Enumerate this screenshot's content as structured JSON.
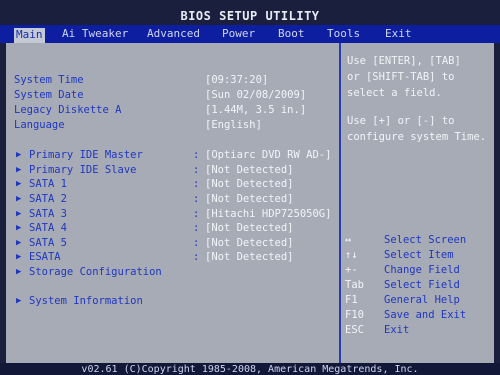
{
  "title": "BIOS SETUP UTILITY",
  "menu": [
    {
      "label": "Main",
      "active": true
    },
    {
      "label": "Ai Tweaker"
    },
    {
      "label": "Advanced"
    },
    {
      "label": "Power"
    },
    {
      "label": "Boot"
    },
    {
      "label": "Tools"
    },
    {
      "label": "Exit"
    }
  ],
  "settings": [
    {
      "label": "System Time",
      "value": "[09:37:20]"
    },
    {
      "label": "System Date",
      "value": "[Sun 02/08/2009]"
    },
    {
      "label": "Legacy Diskette A",
      "value": "[1.44M, 3.5 in.]"
    },
    {
      "label": "Language",
      "value": "[English]"
    }
  ],
  "devices": [
    {
      "label": "Primary IDE Master",
      "value": "[Optiarc DVD RW AD-]"
    },
    {
      "label": "Primary IDE Slave",
      "value": "[Not Detected]"
    },
    {
      "label": "SATA 1",
      "value": "[Not Detected]"
    },
    {
      "label": "SATA 2",
      "value": "[Not Detected]"
    },
    {
      "label": "SATA 3",
      "value": "[Hitachi HDP725050G]"
    },
    {
      "label": "SATA 4",
      "value": "[Not Detected]"
    },
    {
      "label": "SATA 5",
      "value": "[Not Detected]"
    },
    {
      "label": "ESATA",
      "value": "[Not Detected]"
    }
  ],
  "storage_config": "Storage Configuration",
  "system_info": "System Information",
  "help": {
    "p1": "Use [ENTER], [TAB]\nor [SHIFT-TAB] to\nselect a field.",
    "p2": "Use [+] or [-] to\nconfigure system Time."
  },
  "keys": [
    {
      "key": "↔",
      "desc": "Select Screen"
    },
    {
      "key": "↑↓",
      "desc": "Select Item"
    },
    {
      "key": "+-",
      "desc": "Change Field"
    },
    {
      "key": "Tab",
      "desc": "Select Field"
    },
    {
      "key": "F1",
      "desc": "General Help"
    },
    {
      "key": "F10",
      "desc": "Save and Exit"
    },
    {
      "key": "ESC",
      "desc": "Exit"
    }
  ],
  "footer": "v02.61 (C)Copyright 1985-2008, American Megatrends, Inc."
}
